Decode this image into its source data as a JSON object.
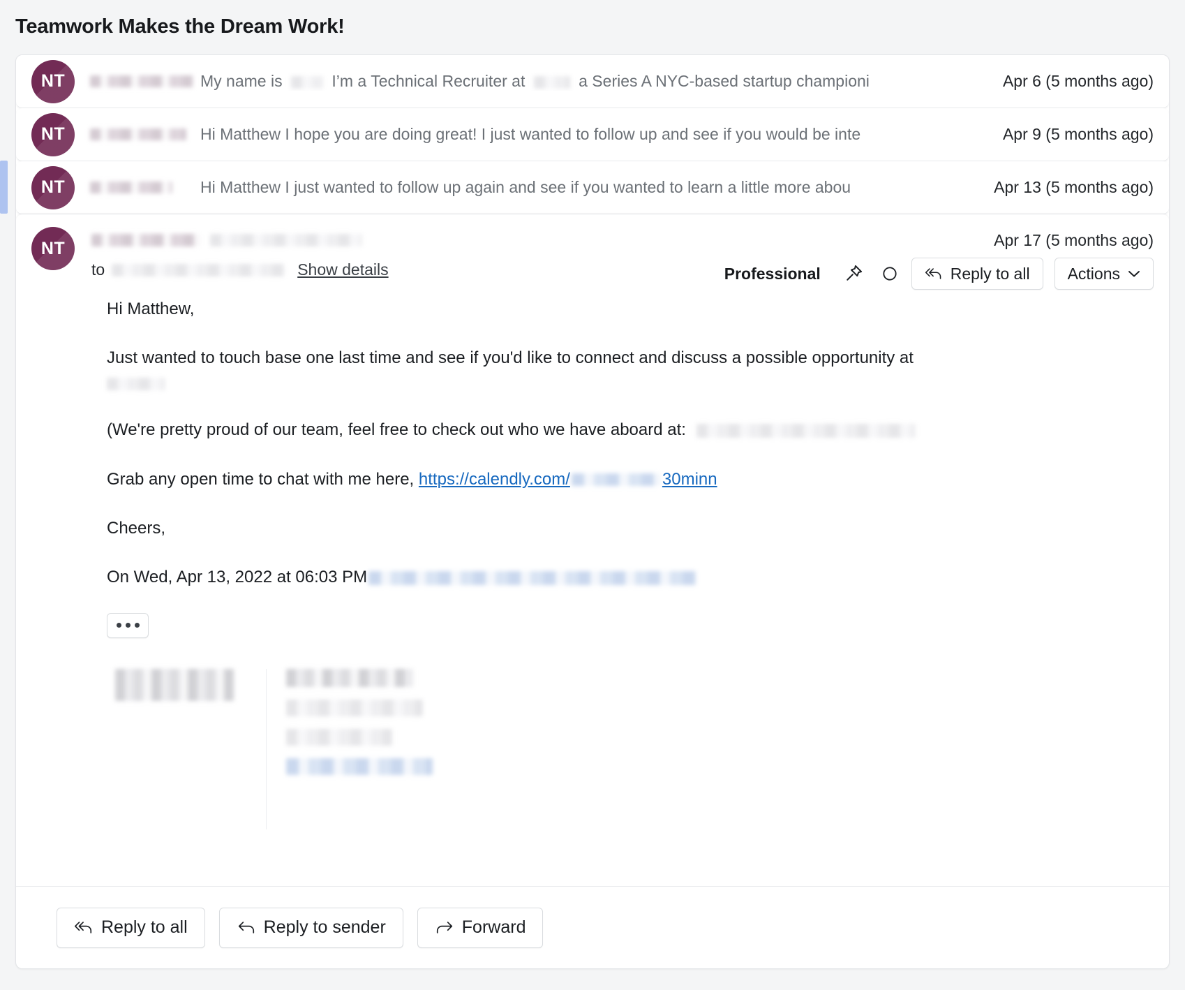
{
  "thread": {
    "title": "Teamwork Makes the Dream Work!"
  },
  "avatar_initials": "NT",
  "collapsed_messages": [
    {
      "avatar": "NT",
      "snippet": "My name is ███ I’m a Technical Recruiter at ███ a Series A NYC-based startup championi",
      "snippet_pre": "My name is",
      "snippet_mid": "I’m a Technical Recruiter at",
      "snippet_post": "a Series A NYC-based startup championi",
      "date": "Apr 6 (5 months ago)"
    },
    {
      "avatar": "NT",
      "snippet": "Hi Matthew I hope you are doing great! I just wanted to follow up and see if you would be inte",
      "date": "Apr 9 (5 months ago)"
    },
    {
      "avatar": "NT",
      "snippet": "Hi Matthew I just wanted to follow up again and see if you wanted to learn a little more abou",
      "date": "Apr 13 (5 months ago)"
    }
  ],
  "expanded_message": {
    "avatar": "NT",
    "to_label": "to",
    "show_details_label": "Show details",
    "date": "Apr 17 (5 months ago)",
    "category_tag": "Professional",
    "pin_icon": "pin-icon",
    "circle_icon": "mark-unread-circle-icon",
    "reply_all_label": "Reply to all",
    "actions_label": "Actions",
    "body": {
      "greeting": "Hi Matthew,",
      "para1_pre": "Just wanted to touch base one last time and see if you'd like to connect and discuss a possible opportunity at",
      "para2_pre": "(We're pretty proud of our team, feel free to check out who we have aboard at:",
      "para3_pre": "Grab any open time to chat with me here,",
      "link_visible_start": "https://calendly.com/",
      "link_visible_end": "30minn",
      "signoff": "Cheers,",
      "quote_header": "On Wed, Apr 13, 2022 at 06:03 PM",
      "expand_quote_label": "•••"
    }
  },
  "footer": {
    "reply_all_label": "Reply to all",
    "reply_sender_label": "Reply to sender",
    "forward_label": "Forward"
  },
  "colors": {
    "avatar": "#722b55",
    "accent_bar": "#aec3f0",
    "link": "#1769bf",
    "page_bg": "#f4f5f6",
    "card_bg": "#ffffff"
  }
}
